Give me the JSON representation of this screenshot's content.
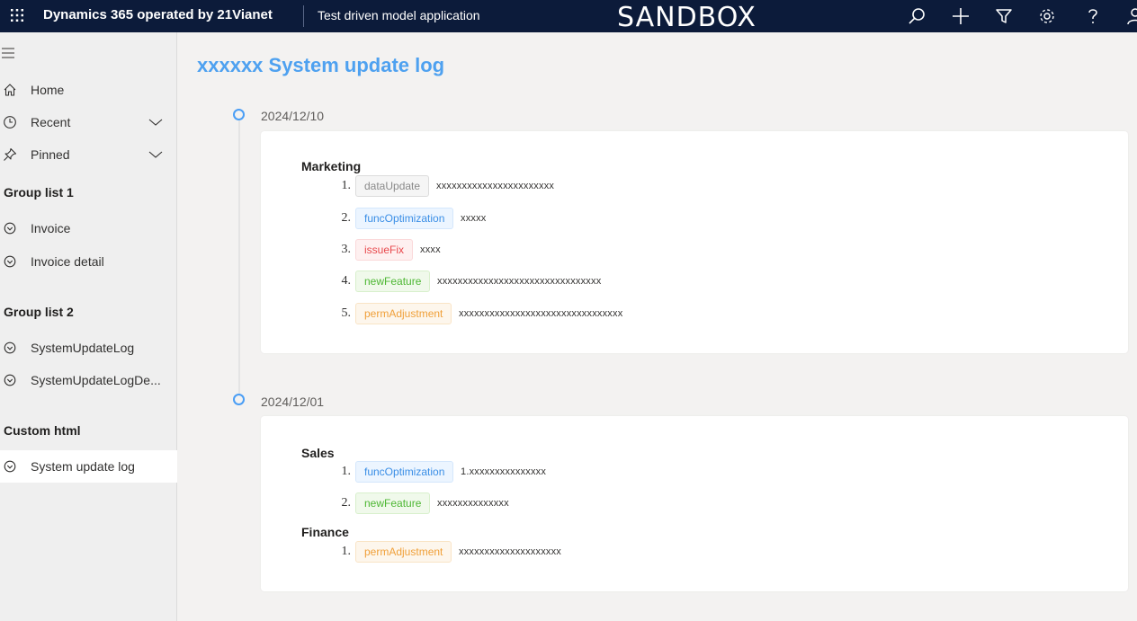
{
  "topbar": {
    "brand": "Dynamics 365 operated by 21Vianet",
    "app_name": "Test driven model application",
    "environment": "SANDBOX",
    "icons": [
      "waffle-icon",
      "search-icon",
      "plus-icon",
      "filter-icon",
      "settings-icon",
      "help-icon",
      "person-icon"
    ]
  },
  "sidebar": {
    "home": "Home",
    "recent": "Recent",
    "pinned": "Pinned",
    "group1": {
      "title": "Group list 1",
      "items": [
        "Invoice",
        "Invoice detail"
      ]
    },
    "group2": {
      "title": "Group list 2",
      "items": [
        "SystemUpdateLog",
        "SystemUpdateLogDe..."
      ]
    },
    "group3": {
      "title": "Custom html",
      "items": [
        "System update log"
      ]
    }
  },
  "page": {
    "title": "xxxxxx System update log"
  },
  "tag_colors": {
    "dataUpdate": {
      "text": "#8a8a8a",
      "bg": "#f5f5f5",
      "border": "#dcdcdc"
    },
    "funcOptimization": {
      "text": "#3a8ee6",
      "bg": "#ecf5ff",
      "border": "#d4e7fc"
    },
    "issueFix": {
      "text": "#e8494d",
      "bg": "#fef0f0",
      "border": "#fbd9da"
    },
    "newFeature": {
      "text": "#4db733",
      "bg": "#f0f9eb",
      "border": "#d8f0cc"
    },
    "permAdjustment": {
      "text": "#f0a03a",
      "bg": "#fdf6ec",
      "border": "#f9e4c6"
    }
  },
  "timeline": [
    {
      "date": "2024/12/10",
      "sections": [
        {
          "title": "Marketing",
          "entries": [
            {
              "num": "1.",
              "tag": "dataUpdate",
              "desc": "xxxxxxxxxxxxxxxxxxxxxxx"
            },
            {
              "num": "2.",
              "tag": "funcOptimization",
              "desc": "xxxxx"
            },
            {
              "num": "3.",
              "tag": "issueFix",
              "desc": "xxxx"
            },
            {
              "num": "4.",
              "tag": "newFeature",
              "desc": "xxxxxxxxxxxxxxxxxxxxxxxxxxxxxxxx"
            },
            {
              "num": "5.",
              "tag": "permAdjustment",
              "desc": "xxxxxxxxxxxxxxxxxxxxxxxxxxxxxxxx"
            }
          ]
        }
      ]
    },
    {
      "date": "2024/12/01",
      "sections": [
        {
          "title": "Sales",
          "entries": [
            {
              "num": "1.",
              "tag": "funcOptimization",
              "desc": "1.xxxxxxxxxxxxxxx"
            },
            {
              "num": "2.",
              "tag": "newFeature",
              "desc": "xxxxxxxxxxxxxx"
            }
          ]
        },
        {
          "title": "Finance",
          "entries": [
            {
              "num": "1.",
              "tag": "permAdjustment",
              "desc": "xxxxxxxxxxxxxxxxxxxx"
            }
          ]
        }
      ]
    }
  ]
}
